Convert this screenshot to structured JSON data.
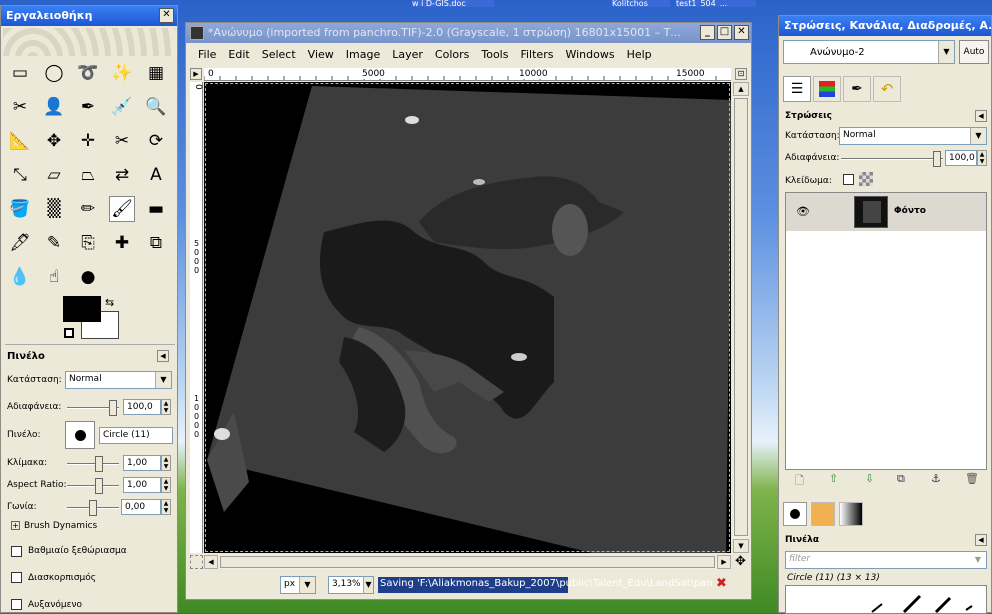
{
  "taskbar": {
    "items": [
      "w i D-GIS.doc",
      "Kolitchos",
      "test1_504_..."
    ]
  },
  "toolbox": {
    "title": "Εργαλειοθήκη",
    "tools": [
      {
        "icon": "rect-select-icon",
        "glyph": "▭"
      },
      {
        "icon": "ellipse-select-icon",
        "glyph": "◯"
      },
      {
        "icon": "lasso-icon",
        "glyph": "➰"
      },
      {
        "icon": "fuzzy-select-icon",
        "glyph": "✨"
      },
      {
        "icon": "color-select-icon",
        "glyph": "▦"
      },
      {
        "icon": "scissors-icon",
        "glyph": "✂"
      },
      {
        "icon": "foreground-select-icon",
        "glyph": "👤"
      },
      {
        "icon": "paths-icon",
        "glyph": "✒"
      },
      {
        "icon": "color-picker-icon",
        "glyph": "💉"
      },
      {
        "icon": "zoom-icon",
        "glyph": "🔍"
      },
      {
        "icon": "measure-icon",
        "glyph": "📐"
      },
      {
        "icon": "move-icon",
        "glyph": "✥"
      },
      {
        "icon": "align-icon",
        "glyph": "✛"
      },
      {
        "icon": "crop-icon",
        "glyph": "✂"
      },
      {
        "icon": "rotate-icon",
        "glyph": "⟳"
      },
      {
        "icon": "scale-icon",
        "glyph": "⤡"
      },
      {
        "icon": "shear-icon",
        "glyph": "▱"
      },
      {
        "icon": "perspective-icon",
        "glyph": "⏢"
      },
      {
        "icon": "flip-icon",
        "glyph": "⇄"
      },
      {
        "icon": "text-icon",
        "glyph": "A"
      },
      {
        "icon": "bucket-fill-icon",
        "glyph": "🪣"
      },
      {
        "icon": "blend-icon",
        "glyph": "▒"
      },
      {
        "icon": "pencil-icon",
        "glyph": "✏"
      },
      {
        "icon": "paintbrush-icon",
        "glyph": "🖌"
      },
      {
        "icon": "eraser-icon",
        "glyph": "▬"
      },
      {
        "icon": "airbrush-icon",
        "glyph": "🖋"
      },
      {
        "icon": "ink-icon",
        "glyph": "✎"
      },
      {
        "icon": "clone-icon",
        "glyph": "⎘"
      },
      {
        "icon": "heal-icon",
        "glyph": "✚"
      },
      {
        "icon": "perspective-clone-icon",
        "glyph": "⧉"
      },
      {
        "icon": "blur-icon",
        "glyph": "💧"
      },
      {
        "icon": "smudge-icon",
        "glyph": "☝"
      },
      {
        "icon": "dodge-burn-icon",
        "glyph": "●"
      }
    ],
    "colors": {
      "fg": "#000000",
      "bg": "#ffffff"
    },
    "options": {
      "title": "Πινέλο",
      "mode_label": "Κατάσταση:",
      "mode_value": "Normal",
      "opacity_label": "Αδιαφάνεια:",
      "opacity_value": "100,0",
      "brush_label": "Πινέλο:",
      "brush_value": "Circle (11)",
      "scale_label": "Κλίμακα:",
      "scale_value": "1,00",
      "aspect_label": "Aspect Ratio:",
      "aspect_value": "1,00",
      "angle_label": "Γωνία:",
      "angle_value": "0,00",
      "dynamics_label": "Brush Dynamics",
      "fade_label": "Βαθμιαίο ξεθώριασμα",
      "jitter_label": "Διασκορπισμός",
      "incremental_label": "Αυξανόμενο"
    }
  },
  "image_window": {
    "title": "*Ανώνυμο (imported from panchro.TIF)-2.0 (Grayscale, 1 στρώση) 16801x15001 – Т...",
    "menu": [
      "File",
      "Edit",
      "Select",
      "View",
      "Image",
      "Layer",
      "Colors",
      "Tools",
      "Filters",
      "Windows",
      "Help"
    ],
    "ruler_h": [
      "0",
      "5000",
      "10000",
      "15000"
    ],
    "ruler_v": [
      "0",
      "5000",
      "10000"
    ],
    "status": {
      "unit": "px",
      "zoom": "3,13%",
      "message": "Saving 'F:\\Aliakmonas_Bakup_2007\\public\\Talent_Edu\\LandSat\\pan..."
    }
  },
  "layers_dock": {
    "title": "Στρώσεις, Κανάλια, Διαδρομές, Α...",
    "image_select": "Ανώνυμο-2",
    "auto_label": "Auto",
    "layers_title": "Στρώσεις",
    "mode_label": "Κατάσταση:",
    "mode_value": "Normal",
    "opacity_label": "Αδιαφάνεια:",
    "opacity_value": "100,0",
    "lock_label": "Κλείδωμα:",
    "layer_name": "Φόντο",
    "brushes_title": "Πινέλα",
    "filter_placeholder": "filter",
    "brush_info": "Circle (11) (13 × 13)"
  }
}
